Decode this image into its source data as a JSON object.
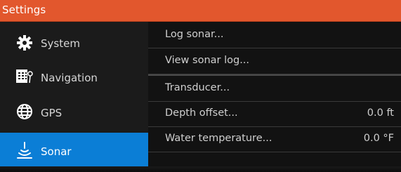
{
  "window": {
    "title": "Settings"
  },
  "sidebar": {
    "items": [
      {
        "label": "System",
        "icon": "gear-icon",
        "selected": false
      },
      {
        "label": "Navigation",
        "icon": "navigation-icon",
        "selected": false
      },
      {
        "label": "GPS",
        "icon": "globe-icon",
        "selected": false
      },
      {
        "label": "Sonar",
        "icon": "sonar-icon",
        "selected": true
      }
    ]
  },
  "menu": {
    "items": [
      {
        "label": "Log sonar...",
        "value": ""
      },
      {
        "label": "View sonar log...",
        "value": ""
      },
      {
        "label": "Transducer...",
        "value": ""
      },
      {
        "label": "Depth offset...",
        "value": "0.0 ft"
      },
      {
        "label": "Water temperature...",
        "value": "0.0 °F"
      }
    ]
  },
  "colors": {
    "accent": "#e2572d",
    "selected": "#0b7ed6",
    "background": "#121212",
    "text": "#cfcfcf"
  }
}
